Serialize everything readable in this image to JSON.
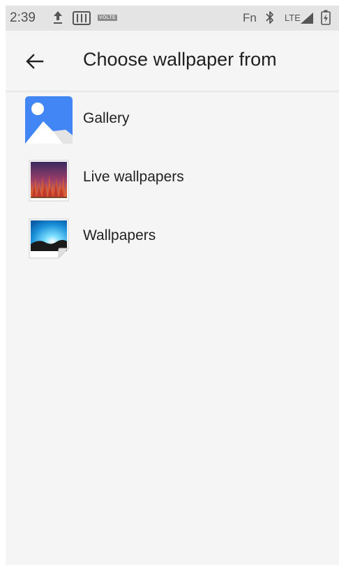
{
  "status_bar": {
    "time": "2:39",
    "volte": "VOLTE",
    "fn": "Fn",
    "network": "LTE",
    "icons": [
      "upload-icon",
      "sim-card-icon",
      "volte-icon",
      "bluetooth-icon",
      "signal-icon",
      "battery-charging-icon"
    ]
  },
  "header": {
    "back_icon": "arrow-left-icon",
    "title": "Choose wallpaper from"
  },
  "options": [
    {
      "label": "Gallery",
      "icon": "gallery-icon"
    },
    {
      "label": "Live wallpapers",
      "icon": "live-wallpapers-icon"
    },
    {
      "label": "Wallpapers",
      "icon": "wallpapers-icon"
    }
  ],
  "colors": {
    "status_bar_bg": "#e4e4e4",
    "background": "#f5f5f5",
    "gallery_blue": "#4285f4",
    "text_primary": "#212121"
  }
}
